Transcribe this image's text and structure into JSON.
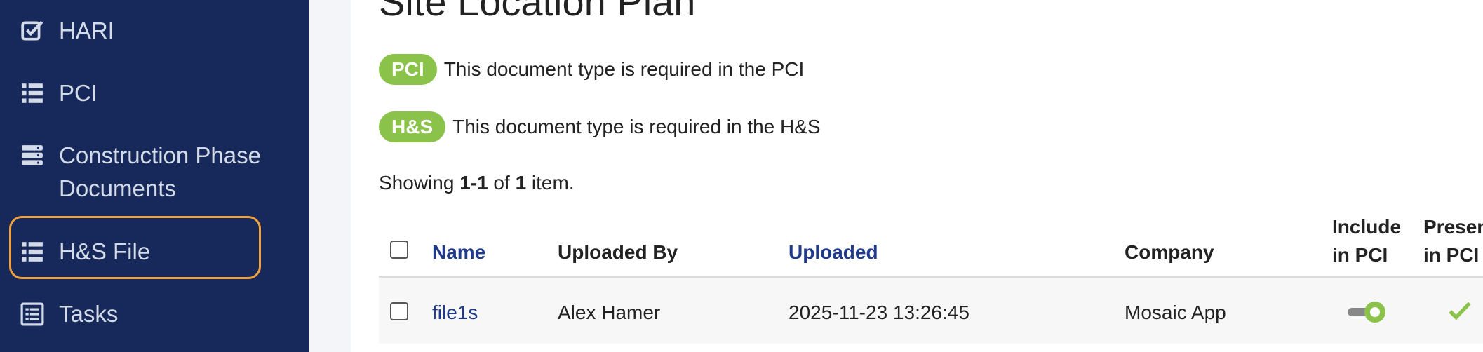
{
  "sidebar": {
    "items": [
      {
        "label": "HARI",
        "icon": "check-square-icon"
      },
      {
        "label": "PCI",
        "icon": "list-icon"
      },
      {
        "label": "Construction Phase Documents",
        "icon": "server-icon"
      },
      {
        "label": "H&S File",
        "icon": "list-icon"
      },
      {
        "label": "Tasks",
        "icon": "list-alt-icon"
      }
    ]
  },
  "main": {
    "title": "Site Location Plan",
    "badges": [
      {
        "label": "PCI",
        "text": "This document type is required in the PCI"
      },
      {
        "label": "H&S",
        "text": "This document type is required in the H&S"
      }
    ],
    "summary": {
      "prefix": "Showing ",
      "range": "1-1",
      "of": " of ",
      "total": "1",
      "suffix": " item."
    },
    "table": {
      "headers": {
        "name": "Name",
        "uploaded_by": "Uploaded By",
        "uploaded": "Uploaded",
        "company": "Company",
        "include_line1": "Include",
        "include_line2": "in PCI",
        "present_line1": "Present",
        "present_line2": "in PCI"
      },
      "rows": [
        {
          "name": "file1s",
          "uploaded_by": "Alex Hamer",
          "uploaded": "2025-11-23 13:26:45",
          "company": "Mosaic App",
          "include_in_pci": true,
          "present_in_pci": true
        }
      ]
    }
  },
  "colors": {
    "sidebar_bg": "#17295a",
    "highlight": "#f0a03c",
    "badge": "#8bc34a",
    "link": "#1f3a8a"
  }
}
